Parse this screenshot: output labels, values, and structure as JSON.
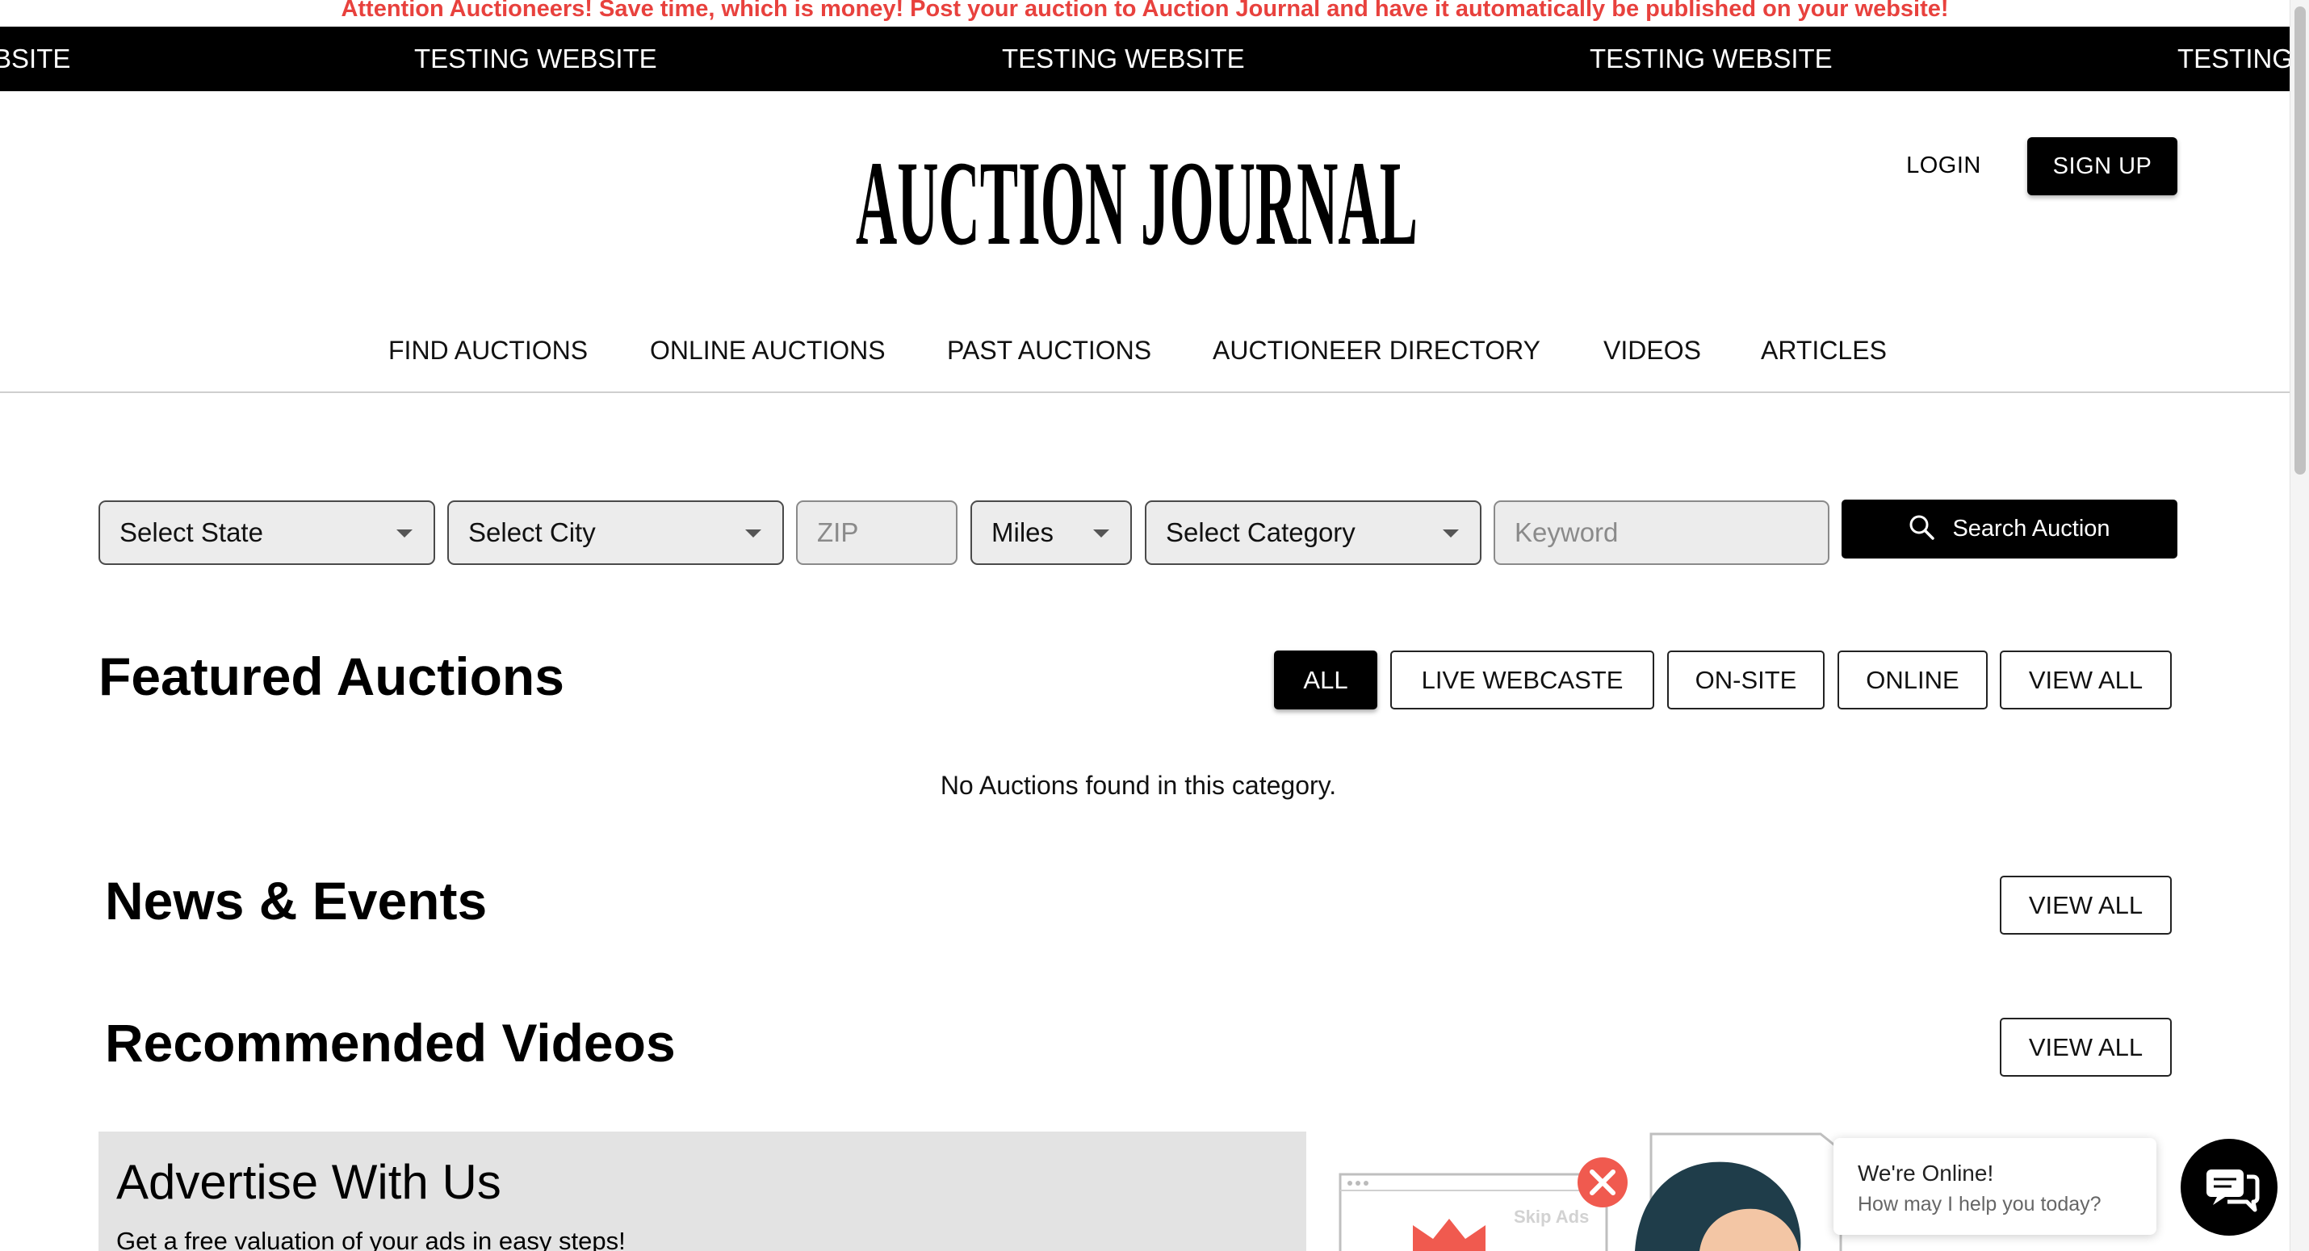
{
  "announcement": "Attention Auctioneers! Save time, which is money! Post your auction to Auction Journal and have it automatically be published on your website!",
  "ticker": [
    "BSITE",
    "TESTING WEBSITE",
    "TESTING WEBSITE",
    "TESTING WEBSITE",
    "TESTING"
  ],
  "brand": {
    "logo_text": "AUCTION JOURNAL"
  },
  "auth": {
    "login": "LOGIN",
    "signup": "SIGN UP"
  },
  "nav": [
    "FIND AUCTIONS",
    "ONLINE AUCTIONS",
    "PAST AUCTIONS",
    "AUCTIONEER DIRECTORY",
    "VIDEOS",
    "ARTICLES"
  ],
  "search": {
    "state": "Select State",
    "city": "Select City",
    "zip_placeholder": "ZIP",
    "miles": "Miles",
    "category": "Select Category",
    "keyword_placeholder": "Keyword",
    "button": "Search Auction"
  },
  "featured": {
    "title": "Featured Auctions",
    "filters": [
      "ALL",
      "LIVE WEBCASTE",
      "ON-SITE",
      "ONLINE"
    ],
    "active_filter": "ALL",
    "view_all": "VIEW ALL",
    "empty": "No Auctions found in this category."
  },
  "news": {
    "title": "News & Events",
    "view_all": "VIEW ALL"
  },
  "videos": {
    "title": "Recommended Videos",
    "view_all": "VIEW ALL"
  },
  "advertise": {
    "title": "Advertise With Us",
    "subtitle": "Get a free valuation of your ads in easy steps!"
  },
  "illustration": {
    "skip_label": "Skip Ads"
  },
  "chat": {
    "title": "We're Online!",
    "subtitle": "How may I help you today?"
  },
  "colors": {
    "announcement": "#e8413d",
    "ticker_bg": "#000000",
    "primary": "#000000",
    "panel": "#e3e3e3",
    "illustration_red": "#f05a4f"
  }
}
